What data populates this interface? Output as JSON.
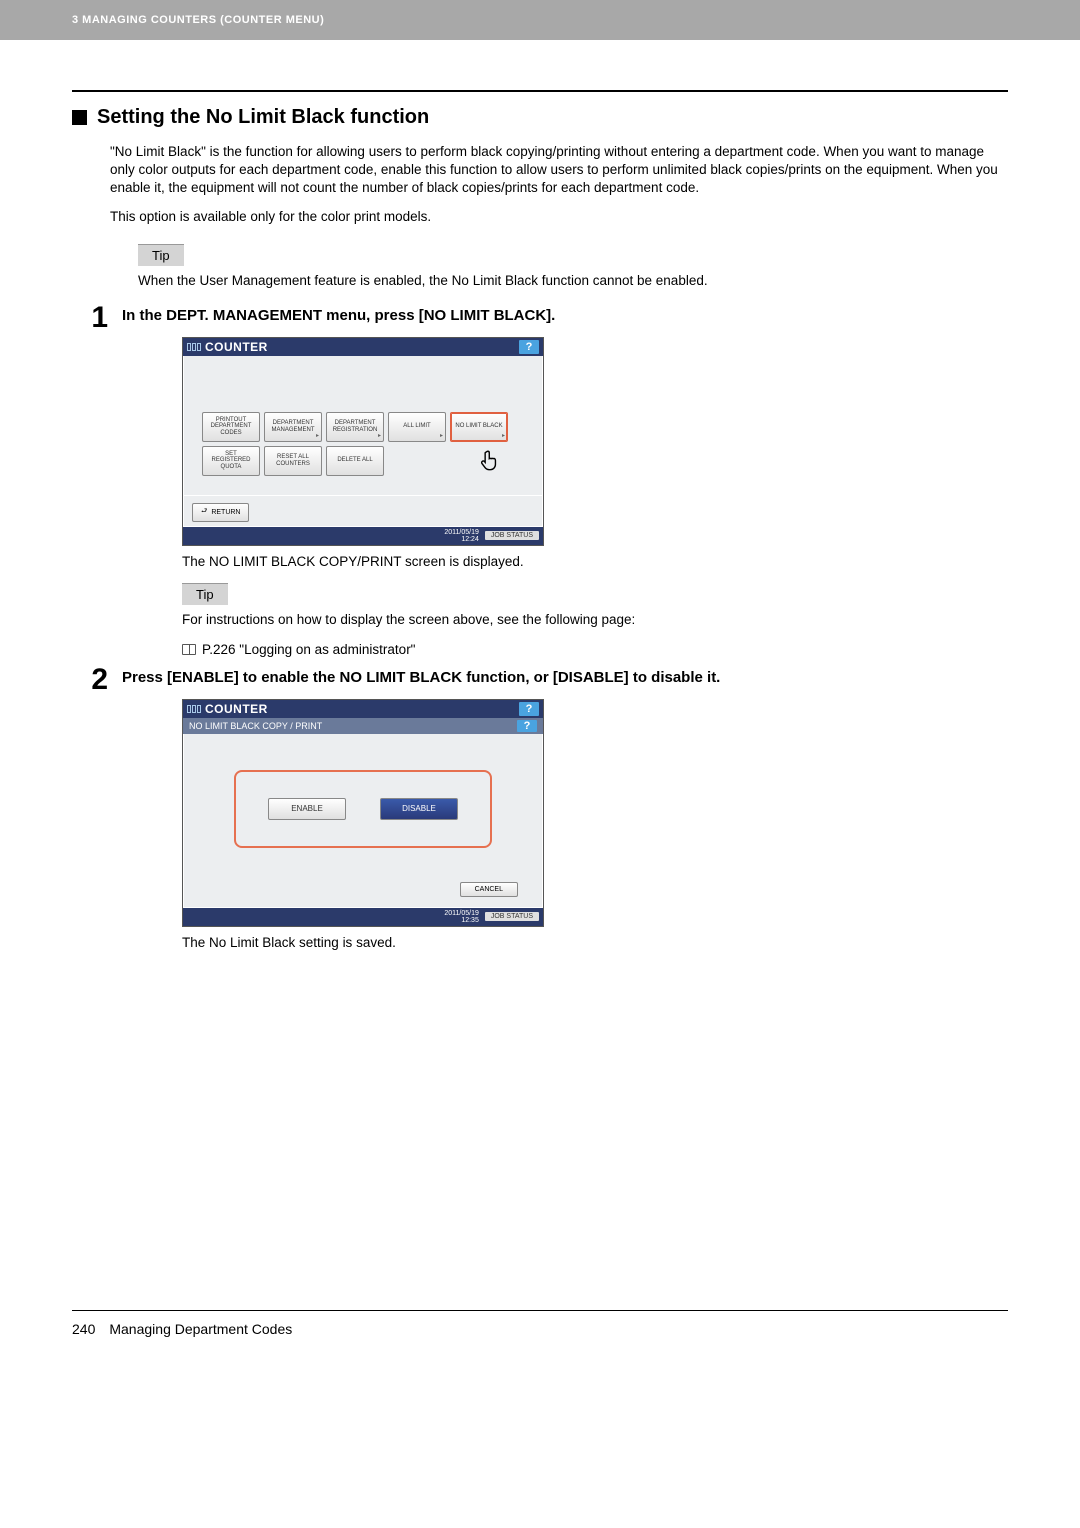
{
  "header": {
    "breadcrumb": "3 MANAGING COUNTERS (COUNTER MENU)"
  },
  "section": {
    "title": "Setting the No Limit Black function",
    "intro": "\"No Limit Black\" is the function for allowing users to perform black copying/printing without entering a department code. When you want to manage only color outputs for each department code, enable this function to allow users to perform unlimited black copies/prints on the equipment. When you enable it, the equipment will not count the number of black copies/prints for each department code.",
    "intro2": "This option is available only for the color print models."
  },
  "tip1": {
    "label": "Tip",
    "body": "When the User Management feature is enabled, the No Limit Black function cannot be enabled."
  },
  "step1": {
    "num": "1",
    "head": "In the DEPT. MANAGEMENT menu, press [NO LIMIT BLACK].",
    "caption": "The NO LIMIT BLACK COPY/PRINT screen is displayed."
  },
  "step2": {
    "num": "2",
    "head": "Press [ENABLE] to enable the NO LIMIT BLACK function, or [DISABLE] to disable it.",
    "caption": "The No Limit Black setting is saved."
  },
  "tip2": {
    "label": "Tip",
    "body": "For instructions on how to display the screen above, see the following page:",
    "ref": "P.226 \"Logging on as administrator\""
  },
  "panel1": {
    "title": "COUNTER",
    "help": "?",
    "buttons": {
      "b0": "PRINTOUT\nDEPARTMENT\nCODES",
      "b1": "DEPARTMENT\nMANAGEMENT",
      "b2": "DEPARTMENT\nREGISTRATION",
      "b3": "ALL LIMIT",
      "b4": "NO LIMIT\nBLACK",
      "b5": "SET\nREGISTERED\nQUOTA",
      "b6": "RESET\nALL\nCOUNTERS",
      "b7": "DELETE ALL"
    },
    "return": "RETURN",
    "datetime": "2011/05/19\n12:24",
    "jobstatus": "JOB STATUS"
  },
  "panel2": {
    "title": "COUNTER",
    "subtitle": "NO LIMIT BLACK COPY / PRINT",
    "help": "?",
    "enable": "ENABLE",
    "disable": "DISABLE",
    "cancel": "CANCEL",
    "datetime": "2011/05/19\n12:35",
    "jobstatus": "JOB STATUS"
  },
  "footer": {
    "pagenum": "240",
    "title": "Managing Department Codes"
  }
}
